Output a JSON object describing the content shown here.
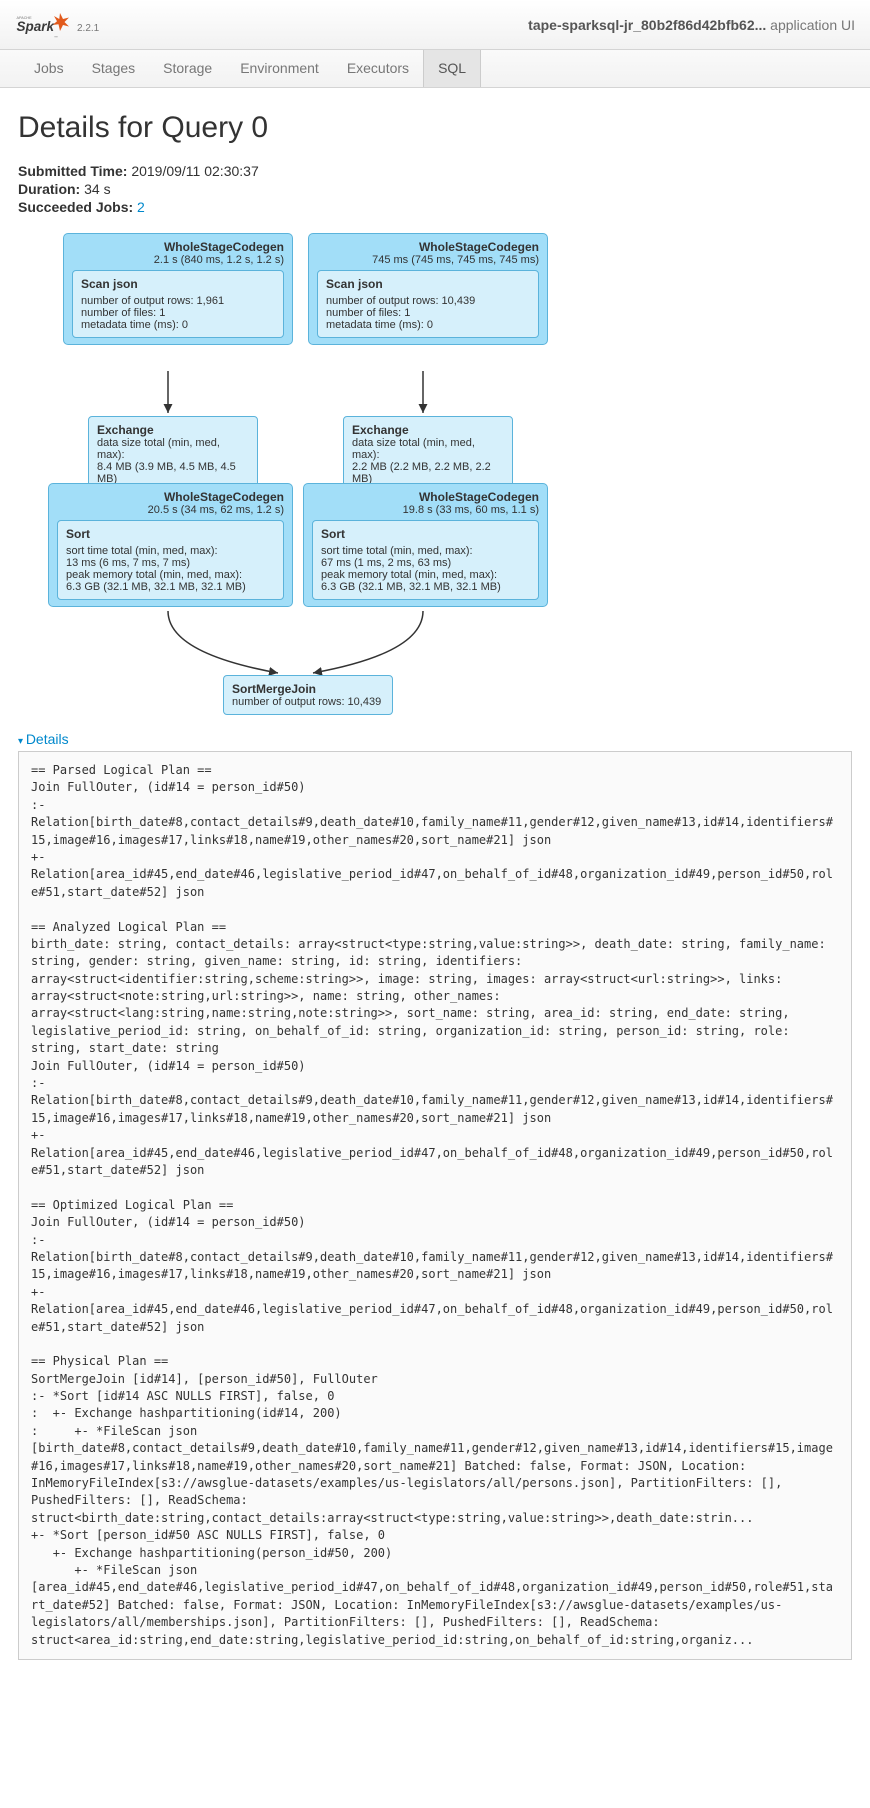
{
  "brand": {
    "name": "Spark",
    "version": "2.2.1"
  },
  "app_title_prefix": "tape-sparksql-jr_80b2f86d42bfb62...",
  "app_title_suffix": " application UI",
  "nav": {
    "jobs": "Jobs",
    "stages": "Stages",
    "storage": "Storage",
    "environment": "Environment",
    "executors": "Executors",
    "sql": "SQL"
  },
  "page_title": "Details for Query 0",
  "meta": {
    "submitted_label": "Submitted Time:",
    "submitted_value": "2019/09/11 02:30:37",
    "duration_label": "Duration:",
    "duration_value": "34 s",
    "succeeded_label": "Succeeded Jobs:",
    "succeeded_link": "2"
  },
  "dag": {
    "wsc1": {
      "title": "WholeStageCodegen",
      "sub": "2.1 s (840 ms, 1.2 s, 1.2 s)",
      "scan_title": "Scan json",
      "scan_l1": "number of output rows: 1,961",
      "scan_l2": "number of files: 1",
      "scan_l3": "metadata time (ms): 0"
    },
    "wsc2": {
      "title": "WholeStageCodegen",
      "sub": "745 ms (745 ms, 745 ms, 745 ms)",
      "scan_title": "Scan json",
      "scan_l1": "number of output rows: 10,439",
      "scan_l2": "number of files: 1",
      "scan_l3": "metadata time (ms): 0"
    },
    "ex1": {
      "title": "Exchange",
      "l1": "data size total (min, med, max):",
      "l2": "8.4 MB (3.9 MB, 4.5 MB, 4.5 MB)"
    },
    "ex2": {
      "title": "Exchange",
      "l1": "data size total (min, med, max):",
      "l2": "2.2 MB (2.2 MB, 2.2 MB, 2.2 MB)"
    },
    "wsc3": {
      "title": "WholeStageCodegen",
      "sub": "20.5 s (34 ms, 62 ms, 1.2 s)",
      "sort_title": "Sort",
      "sort_l1": "sort time total (min, med, max):",
      "sort_l2": "13 ms (6 ms, 7 ms, 7 ms)",
      "sort_l3": "peak memory total (min, med, max):",
      "sort_l4": "6.3 GB (32.1 MB, 32.1 MB, 32.1 MB)"
    },
    "wsc4": {
      "title": "WholeStageCodegen",
      "sub": "19.8 s (33 ms, 60 ms, 1.1 s)",
      "sort_title": "Sort",
      "sort_l1": "sort time total (min, med, max):",
      "sort_l2": "67 ms (1 ms, 2 ms, 63 ms)",
      "sort_l3": "peak memory total (min, med, max):",
      "sort_l4": "6.3 GB (32.1 MB, 32.1 MB, 32.1 MB)"
    },
    "join": {
      "title": "SortMergeJoin",
      "l1": "number of output rows: 10,439"
    }
  },
  "details_label": "Details",
  "plan_text": "== Parsed Logical Plan ==\nJoin FullOuter, (id#14 = person_id#50)\n:-\nRelation[birth_date#8,contact_details#9,death_date#10,family_name#11,gender#12,given_name#13,id#14,identifiers#15,image#16,images#17,links#18,name#19,other_names#20,sort_name#21] json\n+-\nRelation[area_id#45,end_date#46,legislative_period_id#47,on_behalf_of_id#48,organization_id#49,person_id#50,role#51,start_date#52] json\n\n== Analyzed Logical Plan ==\nbirth_date: string, contact_details: array<struct<type:string,value:string>>, death_date: string, family_name: string, gender: string, given_name: string, id: string, identifiers: array<struct<identifier:string,scheme:string>>, image: string, images: array<struct<url:string>>, links: array<struct<note:string,url:string>>, name: string, other_names: array<struct<lang:string,name:string,note:string>>, sort_name: string, area_id: string, end_date: string, legislative_period_id: string, on_behalf_of_id: string, organization_id: string, person_id: string, role: string, start_date: string\nJoin FullOuter, (id#14 = person_id#50)\n:-\nRelation[birth_date#8,contact_details#9,death_date#10,family_name#11,gender#12,given_name#13,id#14,identifiers#15,image#16,images#17,links#18,name#19,other_names#20,sort_name#21] json\n+-\nRelation[area_id#45,end_date#46,legislative_period_id#47,on_behalf_of_id#48,organization_id#49,person_id#50,role#51,start_date#52] json\n\n== Optimized Logical Plan ==\nJoin FullOuter, (id#14 = person_id#50)\n:-\nRelation[birth_date#8,contact_details#9,death_date#10,family_name#11,gender#12,given_name#13,id#14,identifiers#15,image#16,images#17,links#18,name#19,other_names#20,sort_name#21] json\n+-\nRelation[area_id#45,end_date#46,legislative_period_id#47,on_behalf_of_id#48,organization_id#49,person_id#50,role#51,start_date#52] json\n\n== Physical Plan ==\nSortMergeJoin [id#14], [person_id#50], FullOuter\n:- *Sort [id#14 ASC NULLS FIRST], false, 0\n:  +- Exchange hashpartitioning(id#14, 200)\n:     +- *FileScan json [birth_date#8,contact_details#9,death_date#10,family_name#11,gender#12,given_name#13,id#14,identifiers#15,image#16,images#17,links#18,name#19,other_names#20,sort_name#21] Batched: false, Format: JSON, Location: InMemoryFileIndex[s3://awsglue-datasets/examples/us-legislators/all/persons.json], PartitionFilters: [], PushedFilters: [], ReadSchema: struct<birth_date:string,contact_details:array<struct<type:string,value:string>>,death_date:strin...\n+- *Sort [person_id#50 ASC NULLS FIRST], false, 0\n   +- Exchange hashpartitioning(person_id#50, 200)\n      +- *FileScan json [area_id#45,end_date#46,legislative_period_id#47,on_behalf_of_id#48,organization_id#49,person_id#50,role#51,start_date#52] Batched: false, Format: JSON, Location: InMemoryFileIndex[s3://awsglue-datasets/examples/us-legislators/all/memberships.json], PartitionFilters: [], PushedFilters: [], ReadSchema: struct<area_id:string,end_date:string,legislative_period_id:string,on_behalf_of_id:string,organiz..."
}
